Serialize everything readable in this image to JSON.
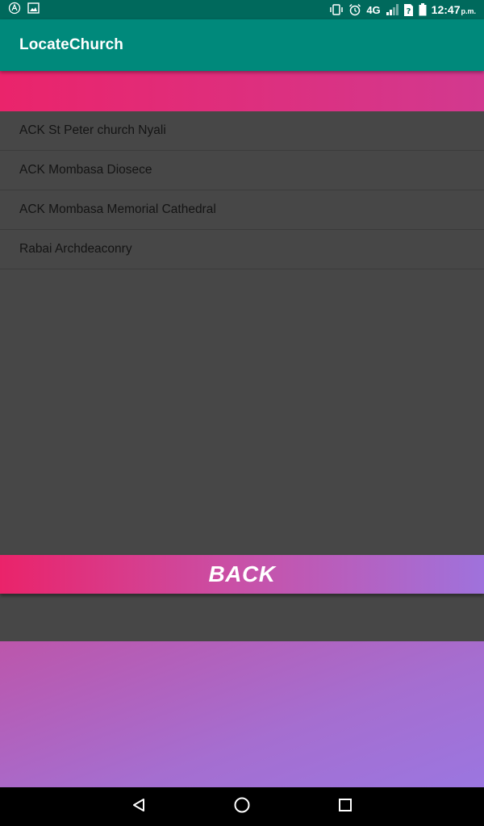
{
  "status_bar": {
    "time": "12:47",
    "ampm": "p.m.",
    "network": "4G",
    "icons": [
      "android-icon",
      "image-icon",
      "vibrate-icon",
      "alarm-icon",
      "signal-icon",
      "no-sim-icon",
      "battery-icon"
    ]
  },
  "app_bar": {
    "title": "LocateChurch"
  },
  "churches": [
    {
      "name": "ACK St Peter church Nyali"
    },
    {
      "name": "ACK Mombasa Diosece"
    },
    {
      "name": "ACK Mombasa Memorial Cathedral"
    },
    {
      "name": "Rabai Archdeaconry"
    }
  ],
  "back_button": {
    "label": "BACK"
  },
  "nav_bar": {
    "icons": [
      "back-triangle-icon",
      "home-circle-icon",
      "recents-square-icon"
    ]
  },
  "colors": {
    "status_bar": "#00695c",
    "app_bar": "#00897b",
    "background": "#474747",
    "accent_pink": "#ea246b",
    "accent_purple": "#9f72dc"
  }
}
